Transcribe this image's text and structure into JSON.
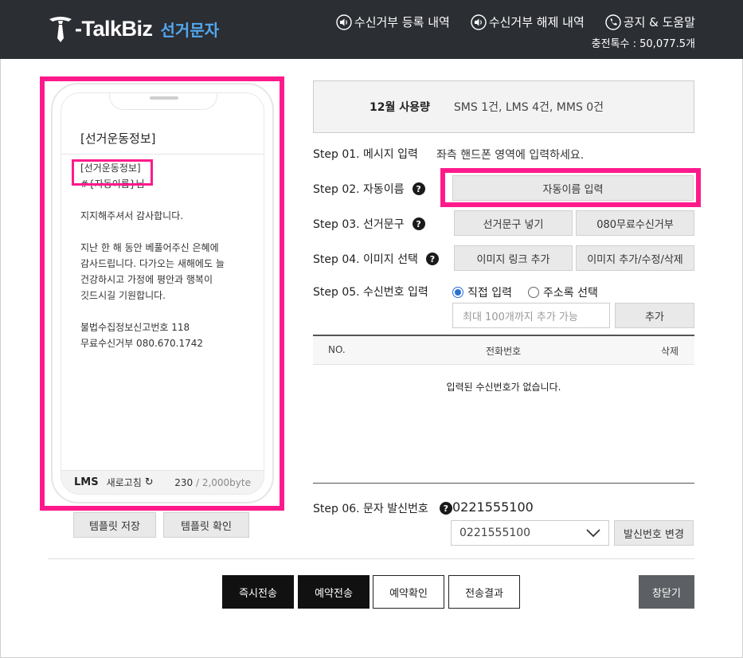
{
  "header": {
    "logo_text": "-TalkBiz",
    "logo_sub": "선거문자",
    "nav": [
      {
        "label": "수신거부 등록 내역",
        "icon": "speaker-icon"
      },
      {
        "label": "수신거부 해제 내역",
        "icon": "speaker-icon"
      },
      {
        "label": "공지 & 도움말",
        "icon": "phone-icon"
      }
    ],
    "charge_text": "충전톡수 : 50,077.5개"
  },
  "phone": {
    "title": "[선거운동정보]",
    "lines": [
      "[선거운동정보]",
      "#{자동이름}님",
      "",
      "지지해주셔서 감사합니다.",
      "",
      "지난 한 해 동안 베풀어주신 은혜에",
      "감사드립니다. 다가오는 새해에도 늘",
      "건강하시고 가정에 평안과 행복이",
      "깃드시길 기원합니다.",
      "",
      "불법수집정보신고번호 118",
      "무료수신거부 080.670.1742"
    ],
    "type_label": "LMS",
    "refresh_label": "새로고침",
    "byte_count": "230",
    "byte_max": " / 2,000byte"
  },
  "template_buttons": {
    "save": "템플릿 저장",
    "confirm": "템플릿 확인"
  },
  "usage": {
    "month": "12월 사용량",
    "stats": "SMS 1건,  LMS 4건,  MMS 0건"
  },
  "steps": {
    "s1_label": "Step 01. 메시지 입력",
    "s1_hint": "좌측 핸드폰 영역에 입력하세요.",
    "s2_label": "Step 02. 자동이름",
    "s2_button": "자동이름 입력",
    "s3_label": "Step 03. 선거문구",
    "s3_btn1": "선거문구 넣기",
    "s3_btn2": "080무료수신거부",
    "s4_label": "Step 04. 이미지 선택",
    "s4_btn1": "이미지 링크 추가",
    "s4_btn2": "이미지 추가/수정/삭제",
    "s5_label": "Step 05. 수신번호 입력",
    "s5_radio1": "직접 입력",
    "s5_radio2": "주소록 선택",
    "s5_placeholder": "최대 100개까지 추가 가능",
    "s5_add": "추가",
    "s6_label": "Step 06. 문자 발신번호",
    "s6_number": "0221555100",
    "s6_select": "0221555100",
    "s6_change": "발신번호 변경"
  },
  "table": {
    "col_no": "NO.",
    "col_phone": "전화번호",
    "col_delete": "삭제",
    "empty": "입력된 수신번호가 없습니다."
  },
  "actions": {
    "send_now": "즉시전송",
    "reserve": "예약전송",
    "reserve_check": "예약확인",
    "result": "전송결과",
    "close": "창닫기"
  },
  "colors": {
    "header_bg": "#2b2e33",
    "highlight": "#ff1a8c",
    "brand_blue": "#52a8f0"
  }
}
